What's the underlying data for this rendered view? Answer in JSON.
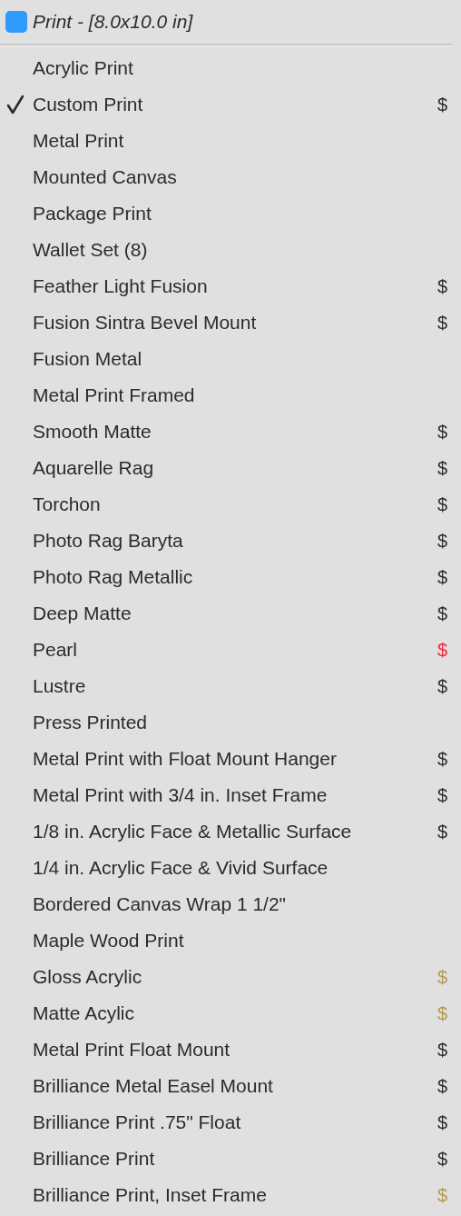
{
  "header": {
    "title": "Print - [8.0x10.0 in]"
  },
  "items": [
    {
      "label": "Acrylic Print",
      "selected": false
    },
    {
      "label": "Custom Print",
      "selected": true,
      "price": "$",
      "color": "#2d2d2d"
    },
    {
      "label": "Metal Print",
      "selected": false
    },
    {
      "label": "Mounted Canvas",
      "selected": false
    },
    {
      "label": "Package Print",
      "selected": false
    },
    {
      "label": "Wallet Set (8)",
      "selected": false
    },
    {
      "label": "Feather Light Fusion",
      "selected": false,
      "price": "$",
      "color": "#2d2d2d"
    },
    {
      "label": "Fusion Sintra Bevel Mount",
      "selected": false,
      "price": "$",
      "color": "#2d2d2d"
    },
    {
      "label": "Fusion Metal",
      "selected": false
    },
    {
      "label": "Metal Print Framed",
      "selected": false
    },
    {
      "label": "Smooth Matte",
      "selected": false,
      "price": "$",
      "color": "#2d2d2d"
    },
    {
      "label": "Aquarelle Rag",
      "selected": false,
      "price": "$",
      "color": "#2d2d2d"
    },
    {
      "label": "Torchon",
      "selected": false,
      "price": "$",
      "color": "#2d2d2d"
    },
    {
      "label": "Photo Rag Baryta",
      "selected": false,
      "price": "$",
      "color": "#2d2d2d"
    },
    {
      "label": "Photo Rag Metallic",
      "selected": false,
      "price": "$",
      "color": "#2d2d2d"
    },
    {
      "label": "Deep Matte",
      "selected": false,
      "price": "$",
      "color": "#2d2d2d"
    },
    {
      "label": "Pearl",
      "selected": false,
      "price": "$",
      "color": "#f0283c"
    },
    {
      "label": "Lustre",
      "selected": false,
      "price": "$",
      "color": "#2d2d2d"
    },
    {
      "label": "Press Printed",
      "selected": false
    },
    {
      "label": "Metal Print with Float Mount Hanger",
      "selected": false,
      "price": "$",
      "color": "#2d2d2d"
    },
    {
      "label": "Metal Print with 3/4 in. Inset Frame",
      "selected": false,
      "price": "$",
      "color": "#2d2d2d"
    },
    {
      "label": "1/8 in. Acrylic Face & Metallic Surface",
      "selected": false,
      "price": "$",
      "color": "#2d2d2d"
    },
    {
      "label": "1/4 in. Acrylic Face & Vivid Surface",
      "selected": false
    },
    {
      "label": "Bordered Canvas Wrap 1 1/2\"",
      "selected": false
    },
    {
      "label": "Maple Wood Print",
      "selected": false
    },
    {
      "label": "Gloss Acrylic",
      "selected": false,
      "price": "$",
      "color": "#b39a50"
    },
    {
      "label": "Matte Acylic",
      "selected": false,
      "price": "$",
      "color": "#b39a50"
    },
    {
      "label": "Metal Print Float Mount",
      "selected": false,
      "price": "$",
      "color": "#2d2d2d"
    },
    {
      "label": "Brilliance Metal Easel Mount",
      "selected": false,
      "price": "$",
      "color": "#2d2d2d"
    },
    {
      "label": "Brilliance Print .75\" Float",
      "selected": false,
      "price": "$",
      "color": "#2d2d2d"
    },
    {
      "label": "Brilliance Print",
      "selected": false,
      "price": "$",
      "color": "#2d2d2d"
    },
    {
      "label": "Brilliance Print, Inset Frame",
      "selected": false,
      "price": "$",
      "color": "#b39a50"
    }
  ]
}
